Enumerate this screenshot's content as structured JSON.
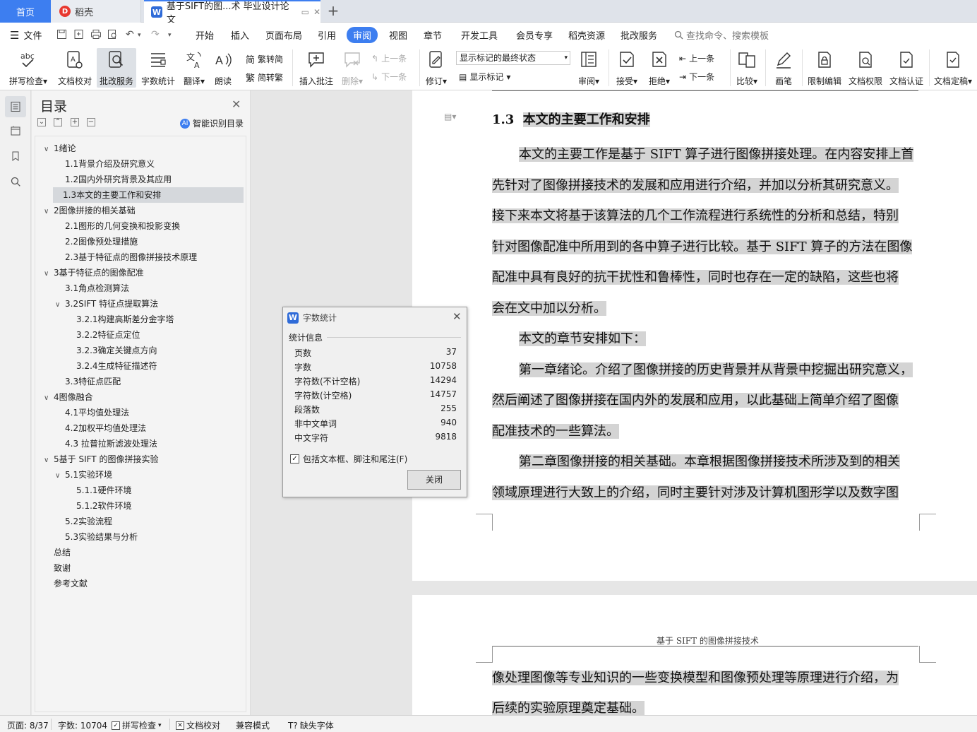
{
  "tabs": {
    "home": "首页",
    "daoke": "稻壳",
    "document": "基于SIFT的图...术 毕业设计论文",
    "new_tab": "+"
  },
  "menu": {
    "file": "文件",
    "items": [
      "开始",
      "插入",
      "页面布局",
      "引用",
      "审阅",
      "视图",
      "章节",
      "开发工具",
      "会员专享",
      "稻壳资源",
      "批改服务"
    ],
    "active": "审阅",
    "search": "查找命令、搜索模板"
  },
  "ribbon": {
    "spell_check": "拼写检查",
    "doc_proof": "文档校对",
    "review_service": "批改服务",
    "word_count": "字数统计",
    "translate": "翻译",
    "read_aloud": "朗读",
    "trad_to_simp": "繁转简",
    "simp_to_trad": "简转繁",
    "insert_comment": "插入批注",
    "delete": "删除",
    "prev": "上一条",
    "next": "下一条",
    "track": "修订",
    "markup_select": "显示标记的最终状态",
    "show_markup": "显示标记",
    "review": "审阅",
    "accept": "接受",
    "reject": "拒绝",
    "prev2": "上一条",
    "next2": "下一条",
    "compare": "比较",
    "pen": "画笔",
    "restrict_edit": "限制编辑",
    "doc_permission": "文档权限",
    "doc_certify": "文档认证",
    "doc_finalize": "文档定稿"
  },
  "toc": {
    "title": "目录",
    "smart": "智能识别目录",
    "items": [
      {
        "text": "1绪论",
        "level": 0,
        "caret": "v"
      },
      {
        "text": "1.1背景介绍及研究意义",
        "level": 1,
        "caret": ""
      },
      {
        "text": "1.2国内外研究背景及其应用",
        "level": 1,
        "caret": ""
      },
      {
        "text": "1.3本文的主要工作和安排",
        "level": 1,
        "caret": "",
        "selected": true
      },
      {
        "text": "2图像拼接的相关基础",
        "level": 0,
        "caret": "v"
      },
      {
        "text": "2.1图形的几何变换和投影变换",
        "level": 1,
        "caret": ""
      },
      {
        "text": "2.2图像预处理措施",
        "level": 1,
        "caret": ""
      },
      {
        "text": "2.3基于特征点的图像拼接技术原理",
        "level": 1,
        "caret": ""
      },
      {
        "text": "3基于特征点的图像配准",
        "level": 0,
        "caret": "v"
      },
      {
        "text": "3.1角点检测算法",
        "level": 1,
        "caret": ""
      },
      {
        "text": "3.2SIFT 特征点提取算法",
        "level": 1,
        "caret": "v"
      },
      {
        "text": "3.2.1构建高斯差分金字塔",
        "level": 2,
        "caret": ""
      },
      {
        "text": "3.2.2特征点定位",
        "level": 2,
        "caret": ""
      },
      {
        "text": "3.2.3确定关键点方向",
        "level": 2,
        "caret": ""
      },
      {
        "text": "3.2.4生成特征描述符",
        "level": 2,
        "caret": ""
      },
      {
        "text": "3.3特征点匹配",
        "level": 1,
        "caret": ""
      },
      {
        "text": "4图像融合",
        "level": 0,
        "caret": "v"
      },
      {
        "text": "4.1平均值处理法",
        "level": 1,
        "caret": ""
      },
      {
        "text": "4.2加权平均值处理法",
        "level": 1,
        "caret": ""
      },
      {
        "text": "4.3 拉普拉斯滤波处理法",
        "level": 1,
        "caret": ""
      },
      {
        "text": "5基于 SIFT 的图像拼接实验",
        "level": 0,
        "caret": "v"
      },
      {
        "text": "5.1实验环境",
        "level": 1,
        "caret": "v"
      },
      {
        "text": "5.1.1硬件环境",
        "level": 2,
        "caret": ""
      },
      {
        "text": "5.1.2软件环境",
        "level": 2,
        "caret": ""
      },
      {
        "text": "5.2实验流程",
        "level": 1,
        "caret": ""
      },
      {
        "text": "5.3实验结果与分析",
        "level": 1,
        "caret": ""
      },
      {
        "text": "总结",
        "level": 0,
        "caret": ""
      },
      {
        "text": "致谢",
        "level": 0,
        "caret": ""
      },
      {
        "text": "参考文献",
        "level": 0,
        "caret": ""
      }
    ]
  },
  "document": {
    "heading_num": "1.3",
    "heading_text": "本文的主要工作和安排",
    "lines": [
      "本文的主要工作是基于 SIFT 算子进行图像拼接处理。在内容安排上首",
      "先针对了图像拼接技术的发展和应用进行介绍，并加以分析其研究意义。",
      "接下来本文将基于该算法的几个工作流程进行系统性的分析和总结，特别",
      "针对图像配准中所用到的各中算子进行比较。基于 SIFT 算子的方法在图像",
      "配准中具有良好的抗干扰性和鲁棒性，同时也存在一定的缺陷，这些也将",
      "会在文中加以分析。",
      "本文的章节安排如下：",
      "第一章绪论。介绍了图像拼接的历史背景并从背景中挖掘出研究意义，",
      "然后阐述了图像拼接在国内外的发展和应用，以此基础上简单介绍了图像",
      "配准技术的一些算法。",
      "第二章图像拼接的相关基础。本章根据图像拼接技术所涉及到的相关",
      "领域原理进行大致上的介绍，同时主要针对涉及计算机图形学以及数字图"
    ],
    "page2_header": "基于 SIFT 的图像拼接技术",
    "page2_lines": [
      "像处理图像等专业知识的一些变换模型和图像预处理等原理进行介绍，为",
      "后续的实验原理奠定基础。"
    ]
  },
  "dialog": {
    "title": "字数统计",
    "group": "统计信息",
    "rows": [
      {
        "label": "页数",
        "value": "37"
      },
      {
        "label": "字数",
        "value": "10758"
      },
      {
        "label": "字符数(不计空格)",
        "value": "14294"
      },
      {
        "label": "字符数(计空格)",
        "value": "14757"
      },
      {
        "label": "段落数",
        "value": "255"
      },
      {
        "label": "非中文单词",
        "value": "940"
      },
      {
        "label": "中文字符",
        "value": "9818"
      }
    ],
    "checkbox": "包括文本框、脚注和尾注(F)",
    "close": "关闭"
  },
  "status": {
    "page": "页面: 8/37",
    "words": "字数: 10704",
    "spell": "拼写检查",
    "proof": "文档校对",
    "compat": "兼容模式",
    "missing_font": "缺失字体"
  },
  "colors": {
    "accent": "#3d7ef0",
    "highlight": "#d4d4d4"
  }
}
